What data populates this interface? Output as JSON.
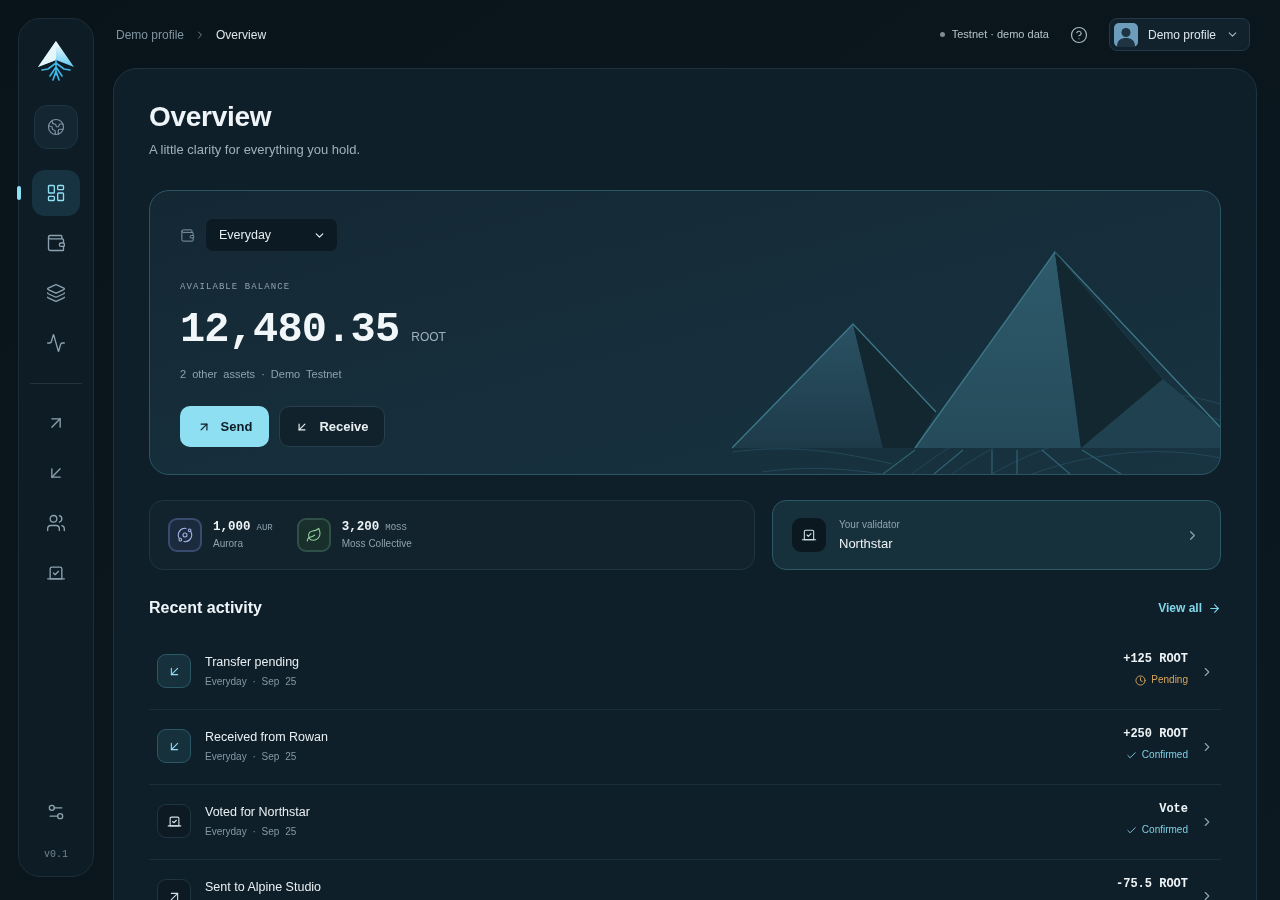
{
  "topbar": {
    "breadcrumb": [
      {
        "label": "Demo profile",
        "current": false
      },
      {
        "label": "Overview",
        "current": true
      }
    ],
    "network": "Testnet · demo data",
    "profile": "Demo profile"
  },
  "sidebar": {
    "primary": [
      {
        "kind": "dashboard",
        "selected": true
      },
      {
        "kind": "wallet",
        "selected": false
      },
      {
        "kind": "layers",
        "selected": false
      },
      {
        "kind": "activity",
        "selected": false
      }
    ],
    "secondary": [
      {
        "kind": "send",
        "selected": false
      },
      {
        "kind": "receive",
        "selected": false
      },
      {
        "kind": "contacts",
        "selected": false
      },
      {
        "kind": "governance",
        "selected": false
      }
    ],
    "version": "v0.1"
  },
  "page": {
    "title": "Overview",
    "subtitle": "A little clarity for everything you hold."
  },
  "balance": {
    "account": "Everyday",
    "label": "AVAILABLE BALANCE",
    "amount": "12,480.35",
    "unit": "ROOT",
    "meta": "2 other assets · Demo Testnet",
    "actions": [
      {
        "kind": "send",
        "label": "Send"
      },
      {
        "kind": "receive",
        "label": "Receive"
      }
    ]
  },
  "assets": [
    {
      "kind": "orbit",
      "amount": "1,000",
      "symbol": "AUR",
      "name": "Aurora",
      "color": "#3a4b70"
    },
    {
      "kind": "leaf",
      "amount": "3,200",
      "symbol": "MOSS",
      "name": "Moss Collective",
      "color": "#2f5047"
    }
  ],
  "validator": {
    "label": "Your validator",
    "name": "Northstar"
  },
  "activity": {
    "title": "Recent activity",
    "link": "View all",
    "items": [
      {
        "kind": "receive",
        "title": "Transfer pending",
        "meta": "Everyday · Sep 25",
        "amount": "+125 ROOT",
        "status": {
          "kind": "pending",
          "label": "Pending"
        }
      },
      {
        "kind": "receive",
        "title": "Received from Rowan",
        "meta": "Everyday · Sep 25",
        "amount": "+250 ROOT",
        "status": {
          "kind": "confirmed",
          "label": "Confirmed"
        }
      },
      {
        "kind": "vote",
        "title": "Voted for Northstar",
        "meta": "Everyday · Sep 25",
        "amount": "Vote",
        "status": {
          "kind": "confirmed",
          "label": "Confirmed"
        }
      },
      {
        "kind": "send",
        "title": "Sent to Alpine Studio",
        "amount": "-75.5 ROOT"
      }
    ]
  }
}
